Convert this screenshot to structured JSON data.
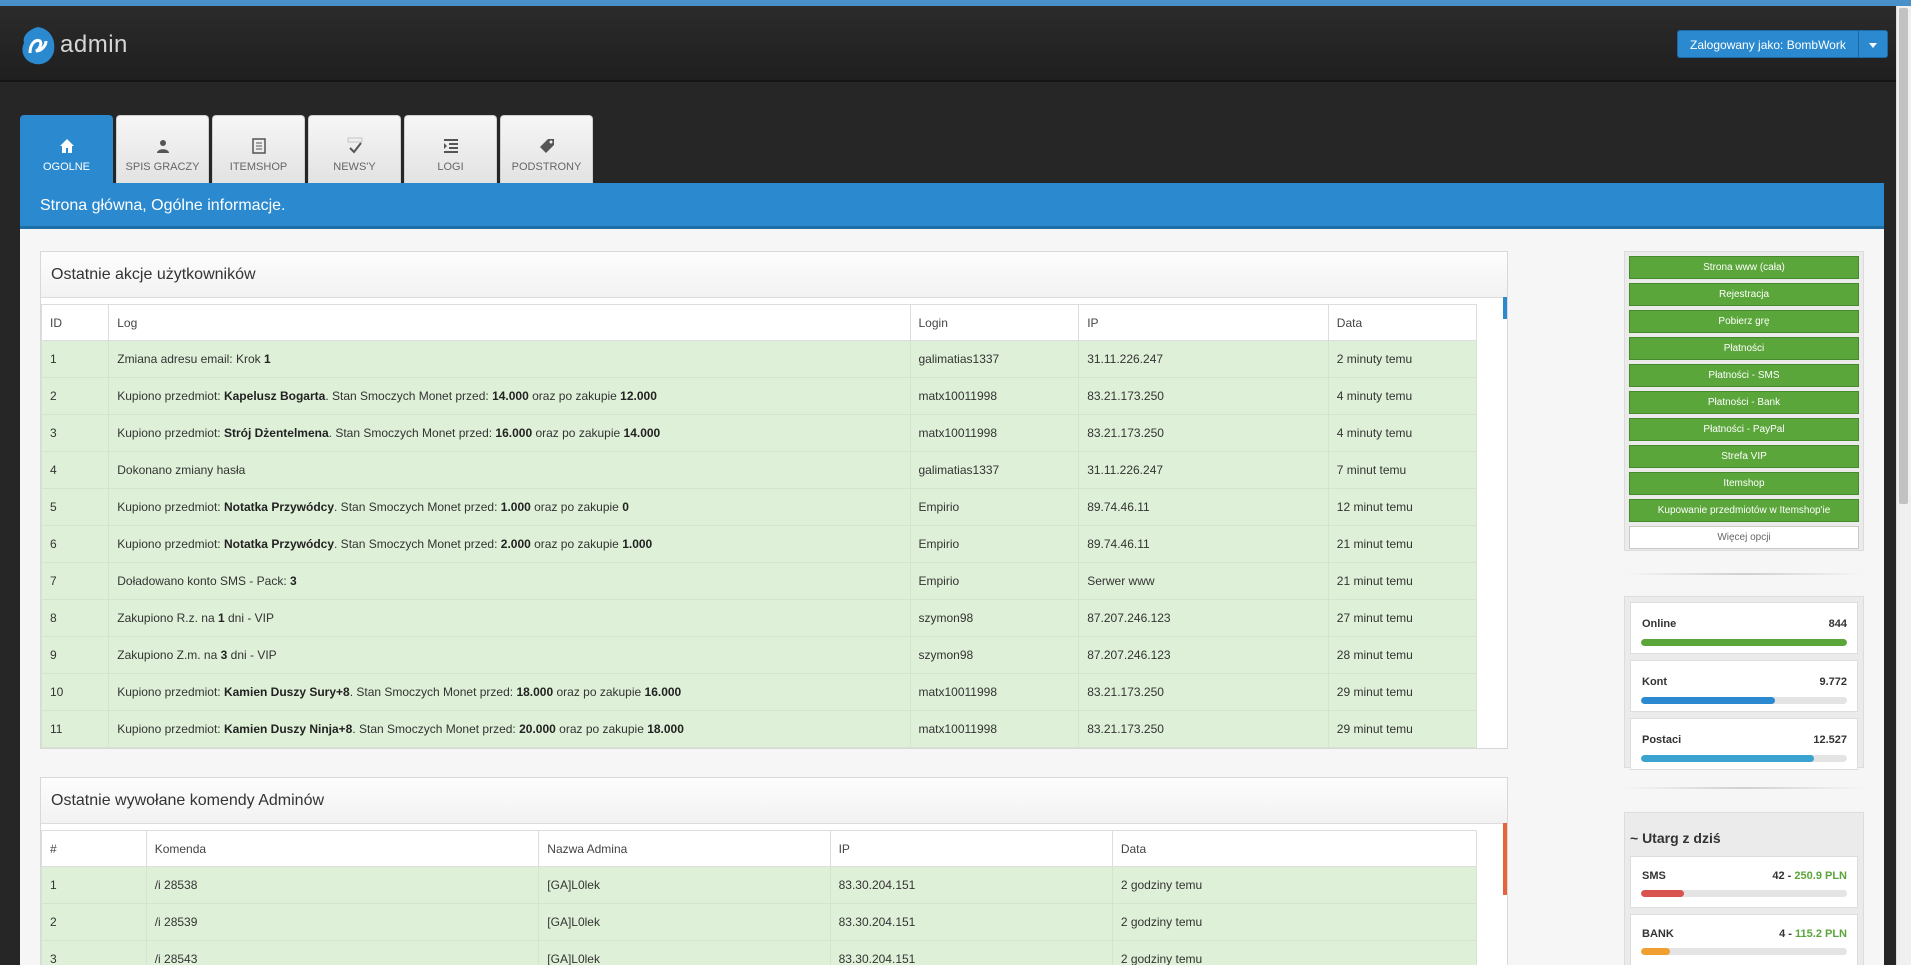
{
  "app": {
    "logo_text": "admin",
    "user_label": "Zalogowany jako: BombWork"
  },
  "tabs": [
    {
      "label": "OGOLNE",
      "icon": "home-icon",
      "active": true
    },
    {
      "label": "SPIS GRACZY",
      "icon": "user-icon",
      "active": false
    },
    {
      "label": "ITEMSHOP",
      "icon": "document-icon",
      "active": false
    },
    {
      "label": "NEWS'Y",
      "icon": "spellcheck-icon",
      "active": false
    },
    {
      "label": "LOGI",
      "icon": "list-indent-icon",
      "active": false
    },
    {
      "label": "PODSTRONY",
      "icon": "tag-icon",
      "active": false
    }
  ],
  "page_title": "Strona główna, Ogólne informacje.",
  "actions_panel": {
    "title": "Ostatnie akcje użytkowników",
    "columns": [
      "ID",
      "Log",
      "Login",
      "IP",
      "Data"
    ],
    "rows": [
      {
        "id": "1",
        "log": "Zmiana adresu email: Krok <b>1</b>",
        "login": "galimatias1337",
        "ip": "31.11.226.247",
        "date": "2 minuty temu"
      },
      {
        "id": "2",
        "log": "Kupiono przedmiot: <b>Kapelusz Bogarta</b>. Stan Smoczych Monet przed: <b>14.000</b> oraz po zakupie <b>12.000</b>",
        "login": "matx10011998",
        "ip": "83.21.173.250",
        "date": "4 minuty temu"
      },
      {
        "id": "3",
        "log": "Kupiono przedmiot: <b>Strój Dżentelmena</b>. Stan Smoczych Monet przed: <b>16.000</b> oraz po zakupie <b>14.000</b>",
        "login": "matx10011998",
        "ip": "83.21.173.250",
        "date": "4 minuty temu"
      },
      {
        "id": "4",
        "log": "Dokonano zmiany hasła",
        "login": "galimatias1337",
        "ip": "31.11.226.247",
        "date": "7 minut temu"
      },
      {
        "id": "5",
        "log": "Kupiono przedmiot: <b>Notatka Przywódcy</b>. Stan Smoczych Monet przed: <b>1.000</b> oraz po zakupie <b>0</b>",
        "login": "Empirio",
        "ip": "89.74.46.11",
        "date": "12 minut temu"
      },
      {
        "id": "6",
        "log": "Kupiono przedmiot: <b>Notatka Przywódcy</b>. Stan Smoczych Monet przed: <b>2.000</b> oraz po zakupie <b>1.000</b>",
        "login": "Empirio",
        "ip": "89.74.46.11",
        "date": "21 minut temu"
      },
      {
        "id": "7",
        "log": "Doładowano konto SMS - Pack: <b>3</b>",
        "login": "Empirio",
        "ip": "Serwer www",
        "date": "21 minut temu"
      },
      {
        "id": "8",
        "log": "Zakupiono R.z. na <b>1</b> dni - VIP",
        "login": "szymon98",
        "ip": "87.207.246.123",
        "date": "27 minut temu"
      },
      {
        "id": "9",
        "log": "Zakupiono Z.m. na <b>3</b> dni - VIP",
        "login": "szymon98",
        "ip": "87.207.246.123",
        "date": "28 minut temu"
      },
      {
        "id": "10",
        "log": "Kupiono przedmiot: <b>Kamien Duszy Sury+8</b>. Stan Smoczych Monet przed: <b>18.000</b> oraz po zakupie <b>16.000</b>",
        "login": "matx10011998",
        "ip": "83.21.173.250",
        "date": "29 minut temu"
      },
      {
        "id": "11",
        "log": "Kupiono przedmiot: <b>Kamien Duszy Ninja+8</b>. Stan Smoczych Monet przed: <b>20.000</b> oraz po zakupie <b>18.000</b>",
        "login": "matx10011998",
        "ip": "83.21.173.250",
        "date": "29 minut temu"
      }
    ]
  },
  "commands_panel": {
    "title": "Ostatnie wywołane komendy Adminów",
    "columns": [
      "#",
      "Komenda",
      "Nazwa Admina",
      "IP",
      "Data"
    ],
    "rows": [
      {
        "n": "1",
        "cmd": "/i 28538",
        "admin": "[GA]L0lek",
        "ip": "83.30.204.151",
        "date": "2 godziny temu"
      },
      {
        "n": "2",
        "cmd": "/i 28539",
        "admin": "[GA]L0lek",
        "ip": "83.30.204.151",
        "date": "2 godziny temu"
      },
      {
        "n": "3",
        "cmd": "/i 28543",
        "admin": "[GA]L0lek",
        "ip": "83.30.204.151",
        "date": "2 godziny temu"
      }
    ]
  },
  "sidebar_menu": [
    "Strona www (cała)",
    "Rejestracja",
    "Pobierz grę",
    "Płatności",
    "Płatności - SMS",
    "Płatności - Bank",
    "Płatności - PayPal",
    "Strefa VIP",
    "Itemshop",
    "Kupowanie przedmiotów w Itemshop'ie"
  ],
  "more_options": "Więcej opcji",
  "stats": [
    {
      "name": "Online",
      "value": "844",
      "fill": 1.0,
      "color": "#5aa63a"
    },
    {
      "name": "Kont",
      "value": "9.772",
      "fill": 0.65,
      "color": "#2a89cf"
    },
    {
      "name": "Postaci",
      "value": "12.527",
      "fill": 0.84,
      "color": "#3ba3cf"
    }
  ],
  "income": {
    "title": "~ Utarg z dziś",
    "items": [
      {
        "name": "SMS",
        "count": "42",
        "sep": " - ",
        "amount": "250.9 PLN",
        "fill": 0.21,
        "color": "#d9534f"
      },
      {
        "name": "BANK",
        "count": "4",
        "sep": " - ",
        "amount": "115.2 PLN",
        "fill": 0.14,
        "color": "#f0a030"
      }
    ]
  },
  "colors": {
    "accent": "#2a89cf",
    "row_bg": "#dff0d8",
    "menu_green": "#5aa63a"
  }
}
